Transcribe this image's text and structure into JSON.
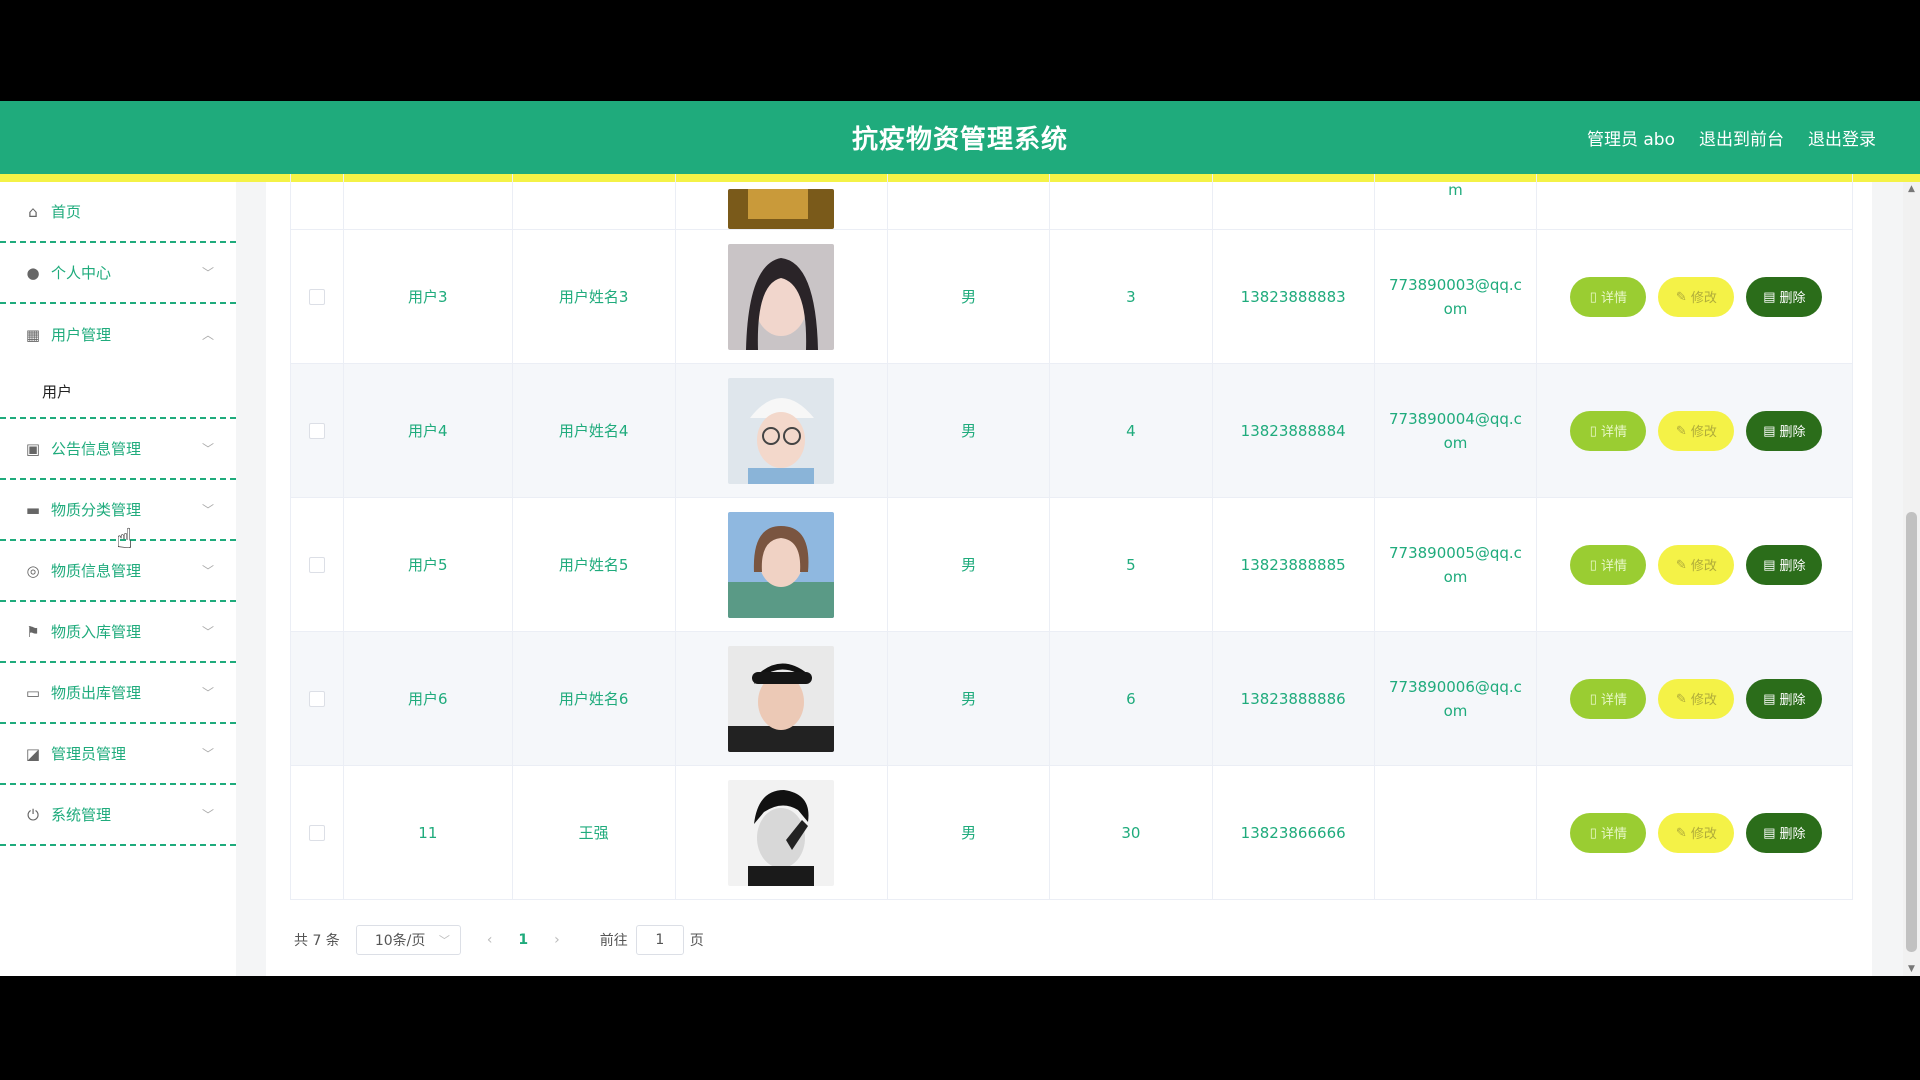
{
  "header": {
    "title": "抗疫物资管理系统",
    "links": [
      "管理员 abo",
      "退出到前台",
      "退出登录"
    ]
  },
  "sidebar": {
    "items": [
      {
        "label": "首页",
        "icon": "home-icon"
      },
      {
        "label": "个人中心",
        "icon": "user-icon"
      },
      {
        "label": "用户管理",
        "icon": "chart-icon"
      },
      {
        "label": "公告信息管理",
        "icon": "clipboard-icon"
      },
      {
        "label": "物质分类管理",
        "icon": "briefcase-icon"
      },
      {
        "label": "物质信息管理",
        "icon": "globe-icon"
      },
      {
        "label": "物质入库管理",
        "icon": "flag-icon"
      },
      {
        "label": "物质出库管理",
        "icon": "message-icon"
      },
      {
        "label": "管理员管理",
        "icon": "wallet-icon"
      },
      {
        "label": "系统管理",
        "icon": "power-icon"
      }
    ],
    "sub_item": "用户"
  },
  "table": {
    "partial_email_tail": "m",
    "rows": [
      {
        "account": "用户3",
        "name": "用户姓名3",
        "sex": "男",
        "age": "3",
        "phone": "13823888883",
        "email": "773890003@qq.com"
      },
      {
        "account": "用户4",
        "name": "用户姓名4",
        "sex": "男",
        "age": "4",
        "phone": "13823888884",
        "email": "773890004@qq.com"
      },
      {
        "account": "用户5",
        "name": "用户姓名5",
        "sex": "男",
        "age": "5",
        "phone": "13823888885",
        "email": "773890005@qq.com"
      },
      {
        "account": "用户6",
        "name": "用户姓名6",
        "sex": "男",
        "age": "6",
        "phone": "13823888886",
        "email": "773890006@qq.com"
      },
      {
        "account": "11",
        "name": "王强",
        "sex": "男",
        "age": "30",
        "phone": "13823866666",
        "email": ""
      }
    ],
    "actions": {
      "detail": "详情",
      "edit": "修改",
      "delete": "删除"
    }
  },
  "pagination": {
    "total": "共 7 条",
    "page_size": "10条/页",
    "current_page": "1",
    "goto_prefix": "前往",
    "goto_value": "1",
    "goto_suffix": "页"
  },
  "colors": {
    "primary": "#1fab7c",
    "accent_yellow": "#f4f247",
    "detail_btn": "#9acd32",
    "delete_btn": "#2b6d1a"
  }
}
